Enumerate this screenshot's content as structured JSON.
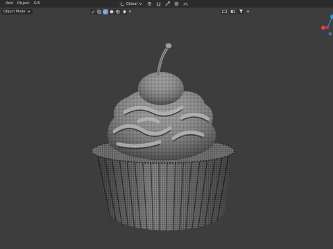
{
  "menubar": {
    "items": [
      {
        "label": "Add",
        "name": "menu-add"
      },
      {
        "label": "Object",
        "name": "menu-object"
      },
      {
        "label": "GIS",
        "name": "menu-gis"
      }
    ]
  },
  "header": {
    "orientation_label": "Global",
    "mode_label": "Object Mode"
  },
  "icons": {
    "vis_group": [
      "restrict-select-icon",
      "xray-icon",
      "wireframe-shading-icon",
      "solid-shading-icon",
      "material-shading-icon",
      "rendered-shading-icon",
      "viewport-dropdown-icon"
    ],
    "right_tools": [
      "overlay-icon",
      "gizmo-toggle-icon",
      "filter-icon",
      "options-icon"
    ]
  },
  "colors": {
    "background": "#3d3d3d",
    "active_button": "#4772b3",
    "axis_x": "#e0434f",
    "axis_y": "#3b8fe0",
    "axis_z": "#8aca3a"
  }
}
